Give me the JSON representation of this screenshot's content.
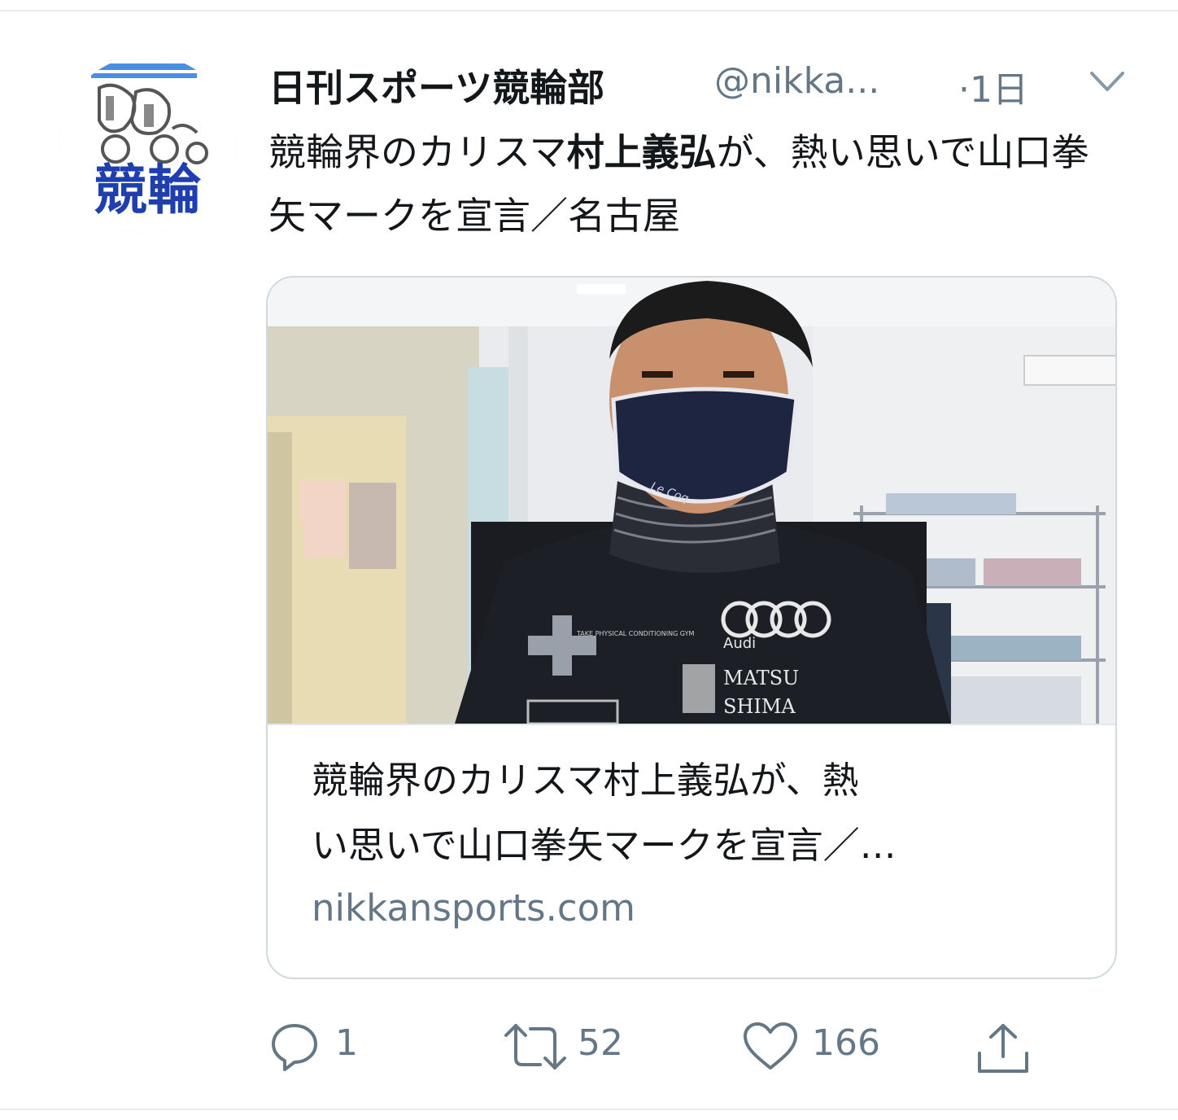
{
  "tweet": {
    "display_name": "日刊スポーツ競輪部",
    "handle": "@nikka...",
    "timestamp": "·1日",
    "text_before": "競輪界のカリスマ",
    "text_bold": "村上義弘",
    "text_after": "が、熱い思いで山口拳矢マークを宣言／名古屋"
  },
  "avatar": {
    "label": "競輪",
    "colors": {
      "label": "#1f3fae",
      "border": "#c9a8ad"
    }
  },
  "card": {
    "title_line1": "競輪界のカリスマ村上義弘が、熱",
    "title_line2": "い思いで山口拳矢マークを宣言／…",
    "domain": "nikkansports.com",
    "image": {
      "mask_logo": "Le Coq",
      "brand_text": "Audi",
      "sponsor_text": "MATSU",
      "sponsor_text2": "SHIMA",
      "sponsor_small": "TAKE PHYSICAL CONDITIONING GYM"
    }
  },
  "actions": {
    "reply_count": "1",
    "retweet_count": "52",
    "like_count": "166"
  },
  "colors": {
    "secondary_text": "#657786",
    "border": "#cfd9de"
  }
}
